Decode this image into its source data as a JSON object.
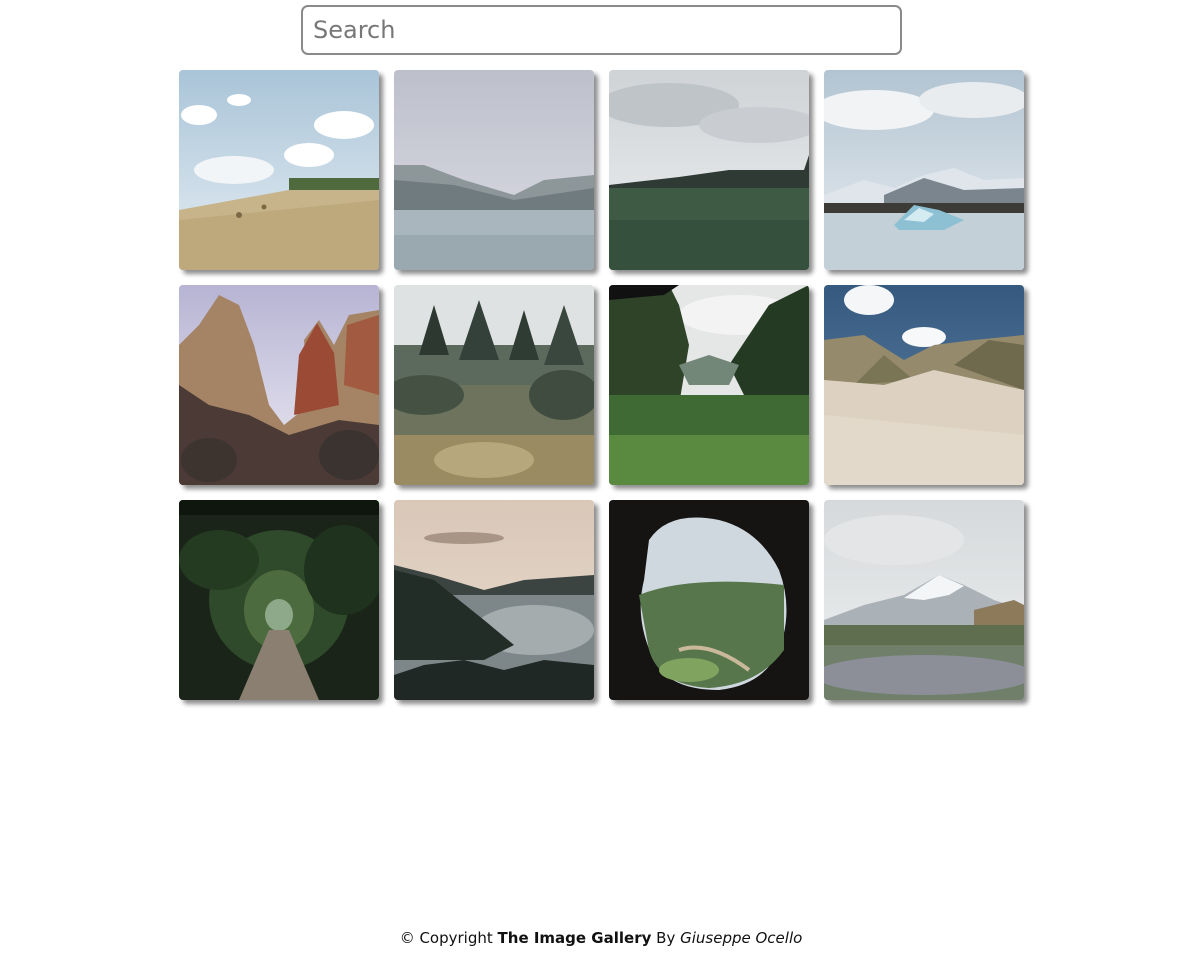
{
  "search": {
    "placeholder": "Search",
    "value": ""
  },
  "gallery": {
    "items": [
      {
        "name": "wheat-field-hay-bales"
      },
      {
        "name": "mountain-lake-misty"
      },
      {
        "name": "green-meadow-cloudy"
      },
      {
        "name": "glacier-lagoon-icebergs"
      },
      {
        "name": "red-rock-canyon"
      },
      {
        "name": "garden-pine-trees"
      },
      {
        "name": "green-valley-forest"
      },
      {
        "name": "sand-dunes-beach"
      },
      {
        "name": "forest-path-tunnel"
      },
      {
        "name": "coastal-river-sunset"
      },
      {
        "name": "cave-view-valley"
      },
      {
        "name": "snowy-mountain-lupine-field"
      }
    ]
  },
  "footer": {
    "copyright": "© Copyright",
    "site_name": "The Image Gallery",
    "by": "By",
    "author": "Giuseppe Ocello"
  }
}
